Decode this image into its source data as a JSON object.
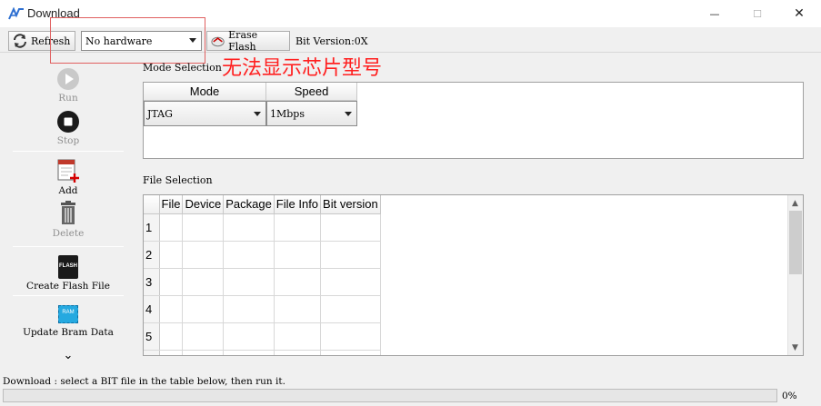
{
  "window": {
    "title": "Download",
    "minimize_glyph": "—",
    "maximize_glyph": "☐",
    "close_glyph": "✕"
  },
  "toolbar": {
    "refresh_label": "Refresh",
    "hardware_select": {
      "value": "No hardware"
    },
    "erase_label": "Erase Flash",
    "bit_version": "Bit Version:0X"
  },
  "annotation": {
    "text": "无法显示芯片型号",
    "color": "#ff2020"
  },
  "sidebar": {
    "run": "Run",
    "stop": "Stop",
    "add": "Add",
    "delete": "Delete",
    "create_flash": "Create Flash File",
    "flash_icon_text": "FLASH",
    "update_bram": "Update Bram Data",
    "ram_icon_text": "RAM",
    "more_glyph": "⌄"
  },
  "mode_selection": {
    "label": "Mode Selection",
    "columns": [
      "Mode",
      "Speed"
    ],
    "mode_value": "JTAG",
    "speed_value": "1Mbps"
  },
  "file_selection": {
    "label": "File Selection",
    "columns": [
      "File",
      "Device",
      "Package",
      "File Info",
      "Bit version"
    ],
    "rows": [
      "1",
      "2",
      "3",
      "4",
      "5"
    ]
  },
  "status": {
    "message": "Download : select a BIT file in the table below, then run it.",
    "progress_percent": 0,
    "progress_label": "0%",
    "accent": "#06b025"
  }
}
